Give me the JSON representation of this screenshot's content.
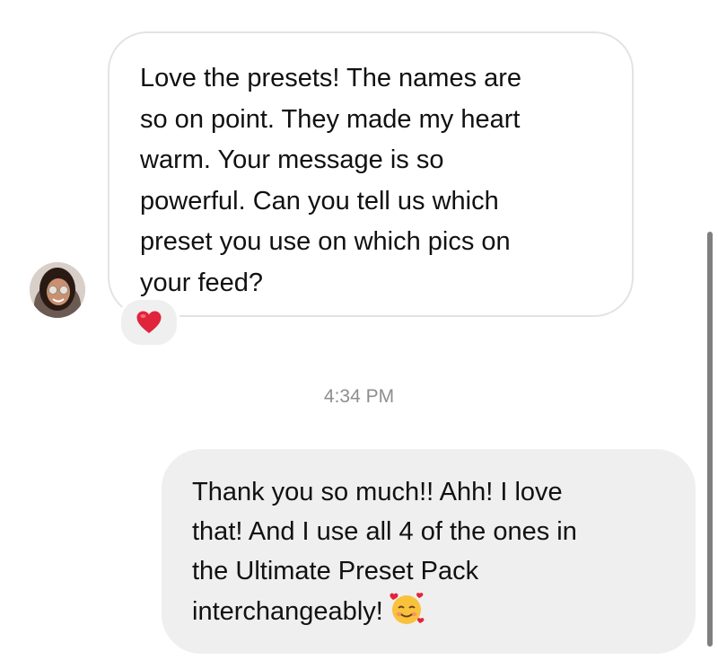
{
  "conversation": {
    "incoming_message": {
      "text": "Love the presets! The names are\nso on point. They made my heart\nwarm. Your message is so\npowerful. Can you tell us which\npreset you use on which pics on\nyour feed?",
      "reaction_icon": "red-heart-icon",
      "sender_avatar": "profile-photo"
    },
    "timestamp": "4:34 PM",
    "outgoing_message": {
      "text": "Thank you so much!! Ahh! I love\nthat! And I use all 4 of the ones in\nthe Ultimate Preset Pack\ninterchangeably!",
      "emoji_icon": "smiling-face-with-hearts-icon"
    }
  },
  "colors": {
    "incoming_bubble_border": "#e3e3e3",
    "outgoing_bubble_background": "#efefef",
    "timestamp_text": "#8e8e8e",
    "heart": "#e0243b"
  }
}
